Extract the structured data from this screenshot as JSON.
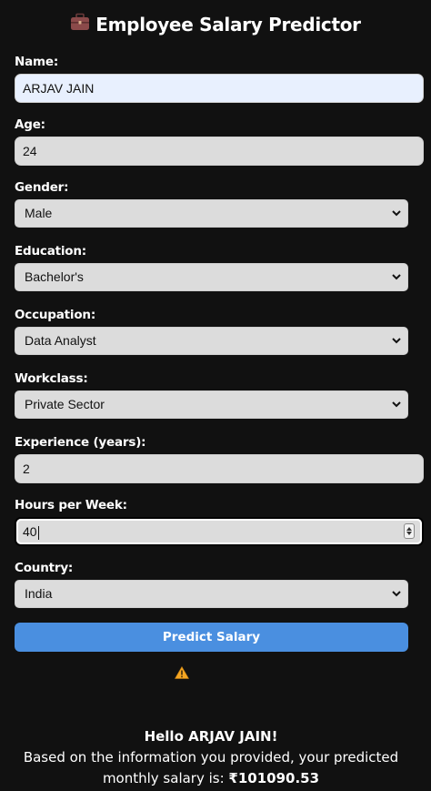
{
  "app": {
    "title": "Employee Salary Predictor",
    "title_icon": "briefcase-icon"
  },
  "form": {
    "name": {
      "label": "Name:",
      "value": "ARJAV JAIN"
    },
    "age": {
      "label": "Age:",
      "value": "24"
    },
    "gender": {
      "label": "Gender:",
      "value": "Male"
    },
    "education": {
      "label": "Education:",
      "value": "Bachelor's"
    },
    "occupation": {
      "label": "Occupation:",
      "value": "Data Analyst"
    },
    "workclass": {
      "label": "Workclass:",
      "value": "Private Sector"
    },
    "experience": {
      "label": "Experience (years):",
      "value": "2"
    },
    "hours": {
      "label": "Hours per Week:",
      "value": "40"
    },
    "country": {
      "label": "Country:",
      "value": "India"
    },
    "submit_label": "Predict Salary"
  },
  "warning_icon": "warning-icon",
  "result": {
    "greeting": "Hello ARJAV JAIN!",
    "message": "Based on the information you provided, your predicted monthly salary is: ",
    "salary": "₹101090.53"
  },
  "colors": {
    "background": "#111111",
    "accent": "#4a8fe0",
    "field_bg": "#dcdcdc",
    "autofill_bg": "#e8f0fe",
    "warning": "#f5a623"
  }
}
